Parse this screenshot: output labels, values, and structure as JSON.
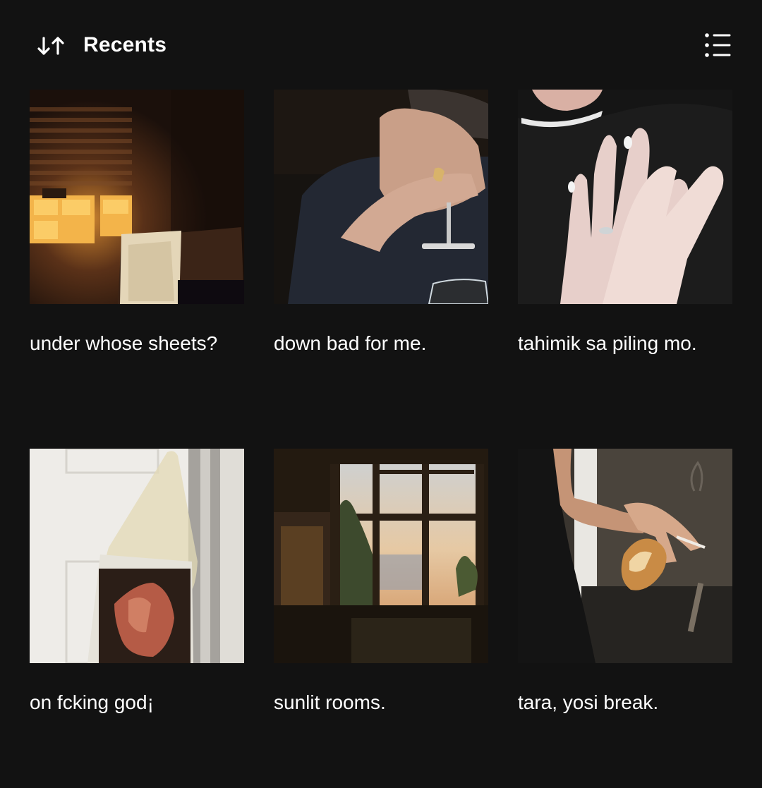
{
  "header": {
    "title": "Recents",
    "sort_icon": "sort-arrows-icon",
    "view_icon": "list-view-icon"
  },
  "playlists": [
    {
      "title": "under whose sheets?",
      "cover": "sunlit bedroom window blinds"
    },
    {
      "title": "down bad for me.",
      "cover": "person hiding face with hands"
    },
    {
      "title": "tahimik sa piling mo.",
      "cover": "hands touching"
    },
    {
      "title": "on fcking god¡",
      "cover": "plastic bag hanging on door"
    },
    {
      "title": "sunlit rooms.",
      "cover": "kitchen window at sunset"
    },
    {
      "title": "tara, yosi break.",
      "cover": "hand holding bread and cigarette"
    }
  ],
  "colors": {
    "background": "#121212",
    "text": "#ffffff"
  }
}
